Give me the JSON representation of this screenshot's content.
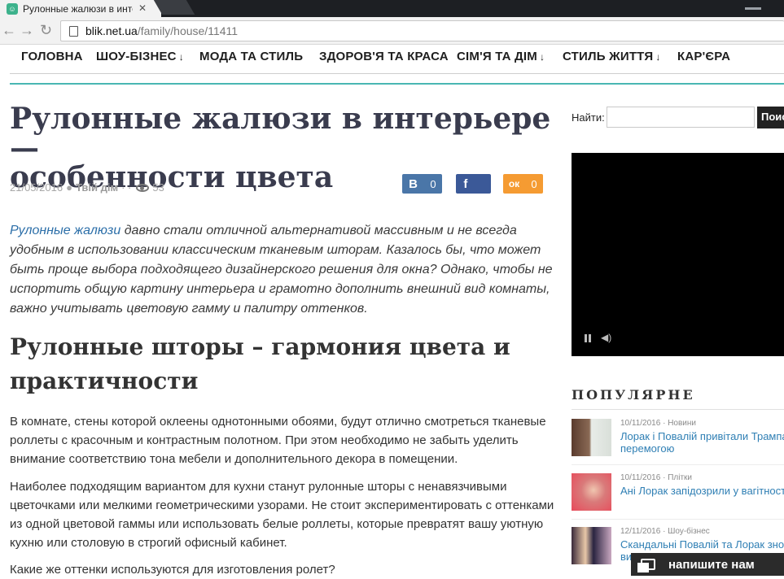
{
  "browser": {
    "tab_title": "Рулонные жалюзи в инте",
    "tab_close": "✕",
    "url_domain": "blik.net.ua",
    "url_path": "/family/house/11411"
  },
  "nav": {
    "items": [
      {
        "label": "ГОЛОВНА",
        "arrow": ""
      },
      {
        "label": "ШОУ-БІЗНЕС",
        "arrow": "↓"
      },
      {
        "label": "МОДА ТА СТИЛЬ",
        "arrow": ""
      },
      {
        "label": "ЗДОРОВ'Я ТА КРАСА",
        "arrow": ""
      },
      {
        "label": "СІМ'Я ТА ДІМ",
        "arrow": "↓"
      },
      {
        "label": "СТИЛЬ ЖИТТЯ",
        "arrow": "↓"
      },
      {
        "label": "КАР'ЄРА",
        "arrow": ""
      }
    ]
  },
  "article": {
    "title_line1": "Рулонные жалюзи в интерьере —",
    "title_line2": "особенности цвета",
    "date": "21/05/2016",
    "bullet": "●",
    "category": "Твій дім",
    "dots": "· ·",
    "views": "53",
    "share": {
      "vk": {
        "logo": "В",
        "count": "0",
        "color": "#4a76a8"
      },
      "fb": {
        "logo": "f",
        "count": "",
        "color": "#3b5998"
      },
      "ok": {
        "logo": "ок",
        "count": "0",
        "color": "#f59b32"
      }
    },
    "lead_link": "Рулонные жалюзи",
    "lead_text": " давно стали отличной альтернативой массивным и не всегда удобным в использовании классическим тканевым шторам. Казалось бы, что может быть проще выбора подходящего дизайнерского решения для окна? Однако, чтобы не испортить общую картину интерьера и грамотно дополнить внешний вид комнаты, важно учитывать цветовую гамму и палитру оттенков.",
    "h2": "Рулонные шторы – гармония цвета и практичности",
    "p1": "В комнате, стены которой оклеены однотонными обоями, будут отлично смотреться тканевые роллеты с красочным и контрастным полотном. При этом необходимо не забыть уделить внимание соответствию тона мебели и дополнительного декора в помещении.",
    "p2": "Наиболее подходящим вариантом для кухни станут рулонные шторы с ненавязчивыми цветочками или мелкими геометрическими узорами. Не стоит экспериментировать с оттенками из одной цветовой гаммы или использовать белые роллеты, которые превратят вашу уютную кухню или столовую в строгий офисный кабинет.",
    "p3": "Какие же оттенки используются для изготовления ролет?"
  },
  "sidebar": {
    "search_label": "Найти:",
    "search_value": "",
    "search_button": "Поиск",
    "popular_heading": "ПОПУЛЯРНЕ",
    "popular": [
      {
        "date": "10/11/2016",
        "section": "Новини",
        "title_line1": "Лорак і Повалій привітали Трампа",
        "title_line2": "перемогою"
      },
      {
        "date": "10/11/2016",
        "section": "Плітки",
        "title_line1": "Ані Лорак запідозрили у вагітності",
        "title_line2": ""
      },
      {
        "date": "12/11/2016",
        "section": "Шоу-бізнес",
        "title_line1": "Скандальні Повалій та Лорак зно",
        "title_line2": "ви"
      }
    ]
  },
  "chat": {
    "label": "напишите нам"
  }
}
